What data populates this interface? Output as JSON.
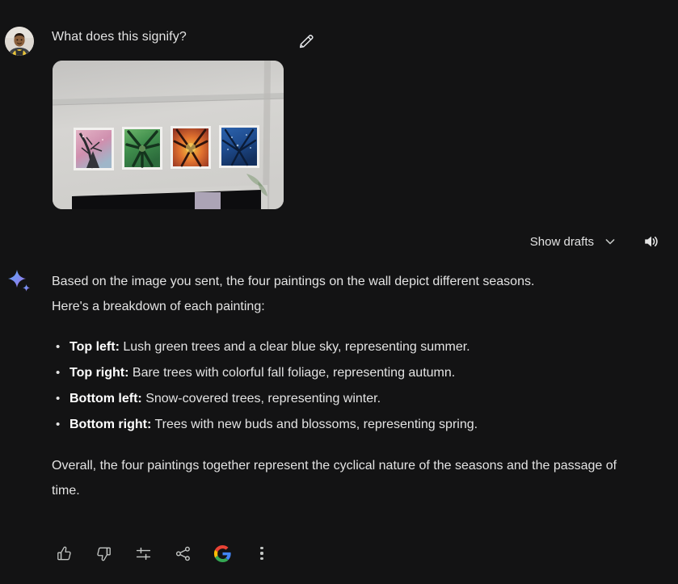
{
  "theme": {
    "background": "#131314",
    "text_primary": "#e3e3e3",
    "text_strong": "#ffffff",
    "icon_stroke": "#c4c7c5"
  },
  "prompt": {
    "text": "What does this signify?",
    "avatar_name": "user-avatar",
    "edit_icon": "pencil-icon"
  },
  "attachment": {
    "alt": "Four framed paintings of tree canopies hanging on a white wall above a dark TV console",
    "paintings": [
      {
        "name": "pink-blossom-painting",
        "color": "#d9a0b4"
      },
      {
        "name": "green-canopy-painting",
        "color": "#4e9a57"
      },
      {
        "name": "orange-autumn-painting",
        "color": "#d96a3c"
      },
      {
        "name": "blue-winter-painting",
        "color": "#2f5fa8"
      }
    ]
  },
  "drafts": {
    "label": "Show drafts",
    "chevron_icon": "chevron-down-icon",
    "speaker_icon": "speaker-icon"
  },
  "response": {
    "sparkle_icon": "gemini-sparkle-icon",
    "intro_line_1": "Based on the image you sent, the four paintings on the wall depict different seasons.",
    "intro_line_2": "Here's a breakdown of each painting:",
    "bullets": [
      {
        "label": "Top left:",
        "text": " Lush green trees and a clear blue sky, representing summer."
      },
      {
        "label": "Top right:",
        "text": " Bare trees with colorful fall foliage, representing autumn."
      },
      {
        "label": "Bottom left:",
        "text": " Snow-covered trees, representing winter."
      },
      {
        "label": "Bottom right:",
        "text": " Trees with new buds and blossoms, representing spring."
      }
    ],
    "outro": "Overall, the four paintings together represent the cyclical nature of the seasons and the passage of time."
  },
  "actions": [
    {
      "name": "thumb-up-icon",
      "label": "Good response"
    },
    {
      "name": "thumb-down-icon",
      "label": "Bad response"
    },
    {
      "name": "tune-icon",
      "label": "Modify response"
    },
    {
      "name": "share-icon",
      "label": "Share & export"
    },
    {
      "name": "google-g-icon",
      "label": "Google it"
    },
    {
      "name": "more-vert-icon",
      "label": "More"
    }
  ]
}
